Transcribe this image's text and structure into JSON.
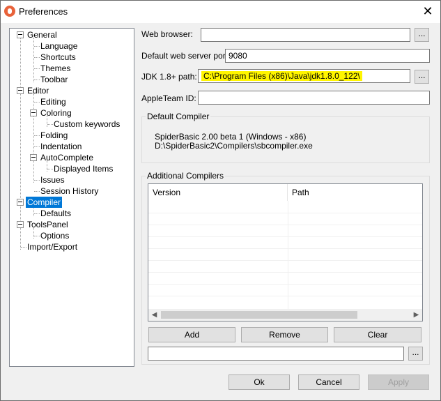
{
  "window": {
    "title": "Preferences",
    "close_glyph": "✕"
  },
  "tree": {
    "items": [
      {
        "label": "General"
      },
      {
        "label": "Language"
      },
      {
        "label": "Shortcuts"
      },
      {
        "label": "Themes"
      },
      {
        "label": "Toolbar"
      },
      {
        "label": "Editor"
      },
      {
        "label": "Editing"
      },
      {
        "label": "Coloring"
      },
      {
        "label": "Custom keywords"
      },
      {
        "label": "Folding"
      },
      {
        "label": "Indentation"
      },
      {
        "label": "AutoComplete"
      },
      {
        "label": "Displayed Items"
      },
      {
        "label": "Issues"
      },
      {
        "label": "Session History"
      },
      {
        "label": "Compiler"
      },
      {
        "label": "Defaults"
      },
      {
        "label": "ToolsPanel"
      },
      {
        "label": "Options"
      },
      {
        "label": "Import/Export"
      }
    ],
    "selected": "Compiler"
  },
  "form": {
    "web_browser_label": "Web browser:",
    "web_browser_value": "",
    "web_server_port_label": "Default web server port:",
    "web_server_port_value": "9080",
    "jdk_label": "JDK 1.8+ path:",
    "jdk_value": "C:\\Program Files (x86)\\Java\\jdk1.8.0_122\\",
    "apple_team_label": "AppleTeam ID:",
    "apple_team_value": "",
    "browse_label": "..."
  },
  "default_compiler": {
    "title": "Default Compiler",
    "line1": "SpiderBasic 2.00 beta 1 (Windows - x86)",
    "line2": "D:\\SpiderBasic2\\Compilers\\sbcompiler.exe"
  },
  "additional_compilers": {
    "title": "Additional Compilers",
    "columns": [
      "Version",
      "Path"
    ],
    "add_label": "Add",
    "remove_label": "Remove",
    "clear_label": "Clear",
    "path_value": "",
    "browse_label": "..."
  },
  "footer": {
    "ok_label": "Ok",
    "cancel_label": "Cancel",
    "apply_label": "Apply"
  },
  "colors": {
    "selection": "#0078d7",
    "highlight": "#fff500",
    "app_icon": "#e8623a"
  }
}
